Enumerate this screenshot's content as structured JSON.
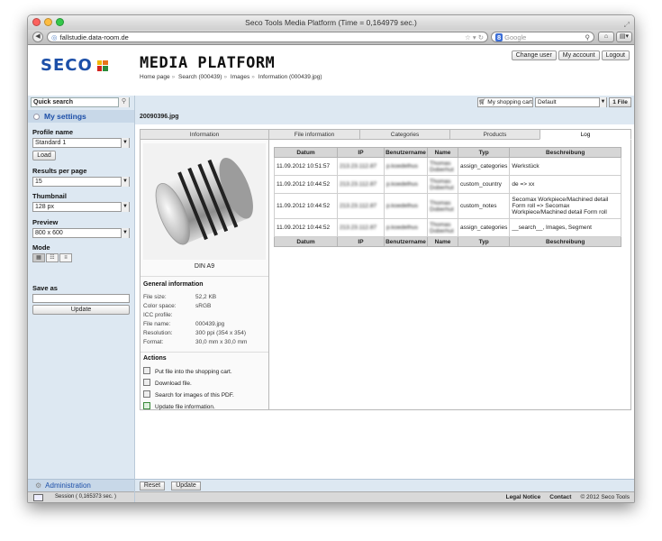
{
  "browser": {
    "title": "Seco Tools Media Platform (Time = 0,164979 sec.)",
    "url": "fallstudie.data-room.de",
    "search_engine": "Google",
    "search_placeholder": "Google"
  },
  "header": {
    "logo_text": "SECO",
    "platform_title": "MEDIA PLATFORM",
    "breadcrumb": [
      "Home page",
      "Search (000439)",
      "Images",
      "Information (000439.jpg)"
    ],
    "buttons": [
      "Change user",
      "My account",
      "Logout"
    ]
  },
  "sidebar": {
    "quick_search_label": "Quick search",
    "my_settings": "My settings",
    "profile_name_label": "Profile name",
    "profile_name_value": "Standard 1",
    "load_button": "Load",
    "results_label": "Results per page",
    "results_value": "15",
    "thumbnail_label": "Thumbnail",
    "thumbnail_value": "128 px",
    "preview_label": "Preview",
    "preview_value": "800 x 600",
    "mode_label": "Mode",
    "save_as_label": "Save as",
    "update_button": "Update",
    "administration": "Administration",
    "status_text": "Session ( 0,165373 sec. )"
  },
  "cartbar": {
    "cart_button": "My shopping cart",
    "cart_select": "Default",
    "file_button": "1 File"
  },
  "file": {
    "name": "20090396.jpg",
    "caption": "DIN A9"
  },
  "tabs": [
    {
      "label": "Information",
      "active": false
    },
    {
      "label": "File information",
      "active": false
    },
    {
      "label": "Categories",
      "active": false
    },
    {
      "label": "Products",
      "active": false
    },
    {
      "label": "Log",
      "active": true
    }
  ],
  "general_info": {
    "title": "General information",
    "rows": [
      {
        "k": "File size:",
        "v": "52,2 KB"
      },
      {
        "k": "Color space:",
        "v": "sRGB"
      },
      {
        "k": "ICC profile:",
        "v": ""
      },
      {
        "k": "File name:",
        "v": "000439.jpg"
      },
      {
        "k": "Resolution:",
        "v": "300 ppi (354 x 354)"
      },
      {
        "k": "Format:",
        "v": "30,0 mm x 30,0 mm"
      }
    ]
  },
  "actions": {
    "title": "Actions",
    "items": [
      "Put file into the shopping cart.",
      "Download file.",
      "Search for images of this PDF.",
      "Update file information."
    ]
  },
  "log": {
    "headers": [
      "Datum",
      "IP",
      "Benutzername",
      "Name",
      "Typ",
      "Beschreibung"
    ],
    "rows": [
      {
        "datum": "11.09.2012 10:51:57",
        "ip": "213.23.112.87",
        "user": "p.koedelhus",
        "name": "Thomas Doberhut",
        "typ": "assign_categories",
        "desc": "Werkstück"
      },
      {
        "datum": "11.09.2012 10:44:52",
        "ip": "213.23.112.87",
        "user": "p.koedelhus",
        "name": "Thomas Doberhut",
        "typ": "custom_country",
        "desc": "de => xx"
      },
      {
        "datum": "11.09.2012 10:44:52",
        "ip": "213.23.112.87",
        "user": "p.koedelhus",
        "name": "Thomas Doberhut",
        "typ": "custom_notes",
        "desc": "Secomax Workpiece/Machined detail Form roll => Secomax Workpiece/Machined detail Form roll"
      },
      {
        "datum": "11.09.2012 10:44:52",
        "ip": "213.23.112.87",
        "user": "p.koedelhus",
        "name": "Thomas Doberhut",
        "typ": "assign_categories",
        "desc": "__search__, Images, Segment"
      }
    ]
  },
  "bottom": {
    "reset": "Reset",
    "update": "Update"
  },
  "footer": {
    "legal": "Legal Notice",
    "contact": "Contact",
    "copyright": "© 2012 Seco Tools"
  },
  "colors": {
    "brand_blue": "#1c4fa8",
    "sidebar_bg": "#dde8f2"
  }
}
